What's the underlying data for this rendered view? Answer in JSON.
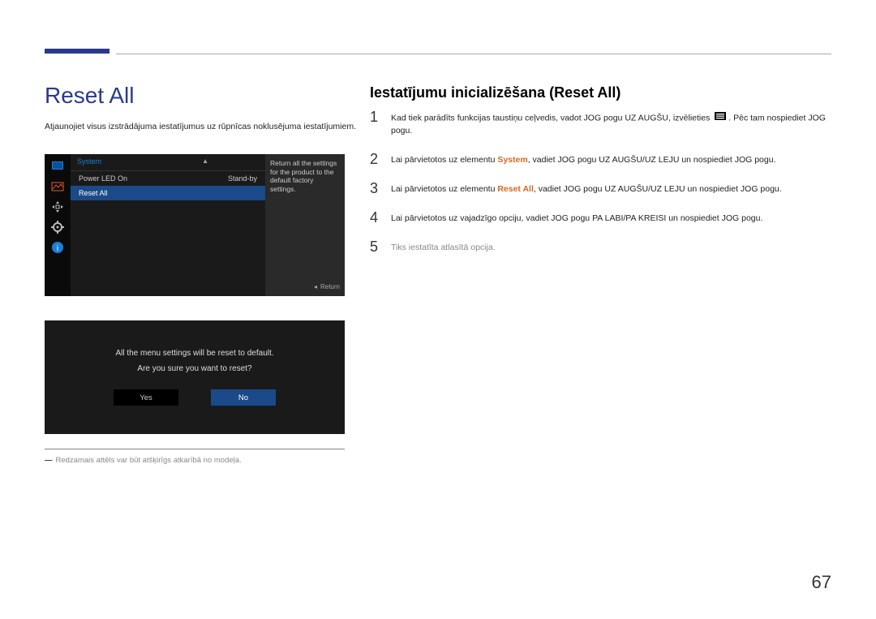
{
  "page": {
    "title": "Reset All",
    "intro": "Atjaunojiet visus izstrādājuma iestatījumus uz rūpnīcas noklusējuma iestatījumiem.",
    "footnote_dash": "―",
    "footnote": "Redzamais attēls var būt atšķirīgs atkarībā no modeļa.",
    "number": "67"
  },
  "osd": {
    "header": "System",
    "rows": [
      {
        "label": "Power LED On",
        "value": "Stand-by"
      },
      {
        "label": "Reset All",
        "value": ""
      }
    ],
    "description": "Return all the settings for the product to the default factory settings.",
    "return_label": "Return",
    "icons": [
      "monitor-icon",
      "picture-icon",
      "move-icon",
      "gear-icon",
      "info-icon"
    ]
  },
  "dialog": {
    "msg1": "All the menu settings will be reset to default.",
    "msg2": "Are you sure you want to reset?",
    "yes": "Yes",
    "no": "No"
  },
  "right": {
    "title": "Iestatījumu inicializēšana (Reset All)",
    "steps": {
      "s1a": "Kad tiek parādīts funkcijas taustiņu ceļvedis, vadot JOG pogu UZ AUGŠU, izvēlieties",
      "s1b": ". Pēc tam nospiediet JOG pogu.",
      "s2a": "Lai pārvietotos uz elementu ",
      "s2b": "System",
      "s2c": ", vadiet JOG pogu UZ AUGŠU/UZ LEJU un nospiediet JOG pogu.",
      "s3a": "Lai pārvietotos uz elementu ",
      "s3b": "Reset All",
      "s3c": ", vadiet JOG pogu UZ AUGŠU/UZ LEJU un nospiediet JOG pogu.",
      "s4": "Lai pārvietotos uz vajadzīgo opciju, vadiet JOG pogu PA LABI/PA KREISI un nospiediet JOG pogu.",
      "s5": "Tiks iestatīta atlasītā opcija."
    }
  }
}
